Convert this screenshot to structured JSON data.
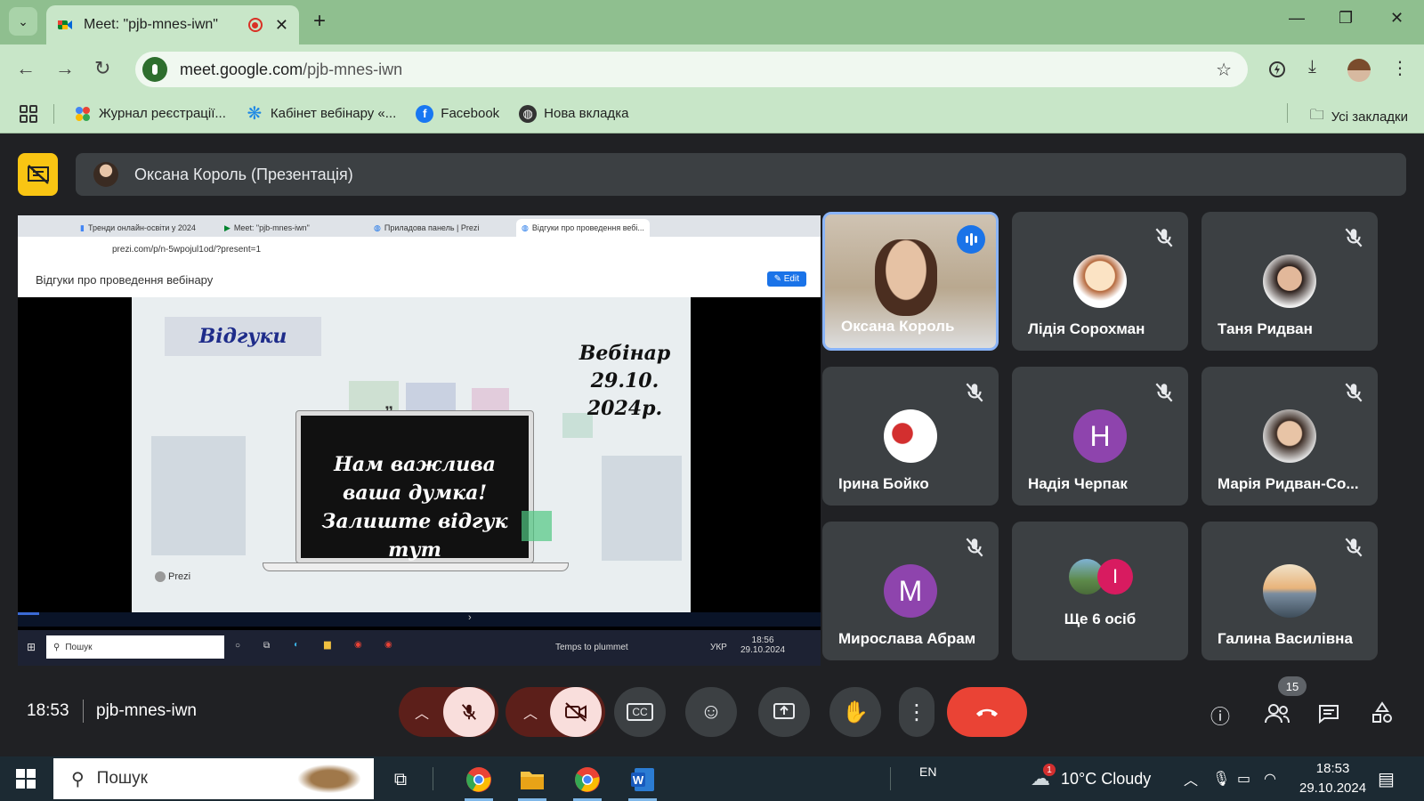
{
  "browser": {
    "tab_title": "Meet: \"pjb-mnes-iwn\"",
    "url_host": "meet.google.com",
    "url_path": "/pjb-mnes-iwn",
    "bookmarks": [
      {
        "label": "Журнал реєстрації..."
      },
      {
        "label": "Кабінет вебінару «..."
      },
      {
        "label": "Facebook"
      },
      {
        "label": "Нова вкладка"
      }
    ],
    "all_bookmarks": "Усі закладки"
  },
  "meet": {
    "presenter_label": "Оксана Король (Презентація)",
    "shared_screen": {
      "tabs": [
        "Тренди онлайн-освіти у 2024",
        "Meet: \"pjb-mnes-iwn\"",
        "Приладова панель | Prezi",
        "Відгуки про проведення вебі..."
      ],
      "url": "prezi.com/p/n-5wpojul1od/?present=1",
      "page_title": "Відгуки про проведення вебінару",
      "edit_label": "Edit",
      "slide": {
        "title": "Відгуки",
        "webinar_lines": [
          "Вебінар",
          "29.10.",
          "2024р."
        ],
        "laptop_lines": [
          "Нам важлива",
          "ваша думка!",
          "Залиште відгук тут"
        ],
        "logo": "Prezi"
      },
      "taskbar": {
        "search": "Пошук",
        "weather": "Temps to plummet",
        "lang": "УКР",
        "time": "18:56",
        "date": "29.10.2024"
      }
    },
    "participants": [
      {
        "name": "Оксана Король",
        "speaking": true
      },
      {
        "name": "Лідія Сорохман",
        "muted": true
      },
      {
        "name": "Таня Ридван",
        "muted": true
      },
      {
        "name": "Ірина Бойко",
        "muted": true
      },
      {
        "name": "Надія Черпак",
        "muted": true,
        "initial": "Н",
        "color": "#8e44ad"
      },
      {
        "name": "Марія Ридван-Со...",
        "muted": true
      },
      {
        "name": "Мирослава Абрам",
        "muted": true,
        "initial": "М",
        "color": "#8e44ad"
      },
      {
        "name": "Ще 6 осіб",
        "extra_initial": "І"
      },
      {
        "name": "Галина Василівна",
        "muted": true
      }
    ],
    "meeting_time": "18:53",
    "meeting_code": "pjb-mnes-iwn",
    "participant_count": "15"
  },
  "taskbar": {
    "search": "Пошук",
    "lang": "EN",
    "weather_badge": "1",
    "weather": "10°C  Cloudy",
    "time": "18:53",
    "date": "29.10.2024"
  },
  "colors": {
    "chrome_frame": "#8fbf8f",
    "chrome_toolbar": "#c8e6c8",
    "meet_bg": "#202124",
    "tile_bg": "#3c4043",
    "presenting_accent": "#f9c513",
    "end_call": "#ea4335"
  }
}
